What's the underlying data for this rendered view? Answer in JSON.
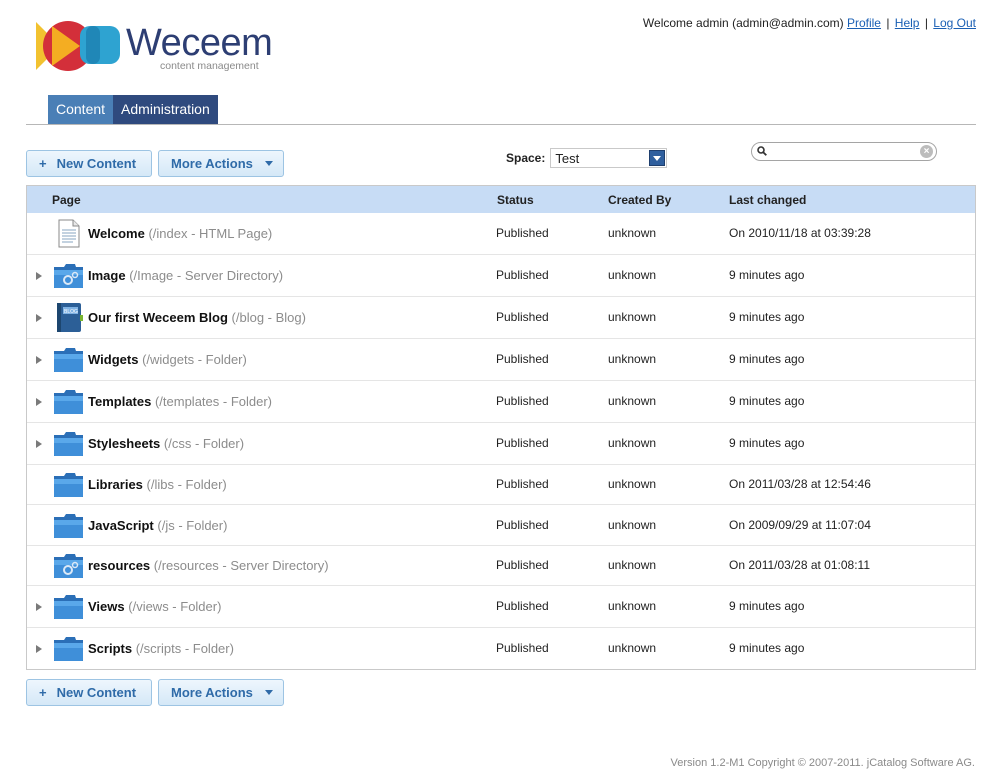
{
  "logo": {
    "word": "Weceem",
    "sub": "content management"
  },
  "user": {
    "welcome": "Welcome admin (admin@admin.com)",
    "profile": "Profile",
    "help": "Help",
    "logout": "Log Out",
    "sep": "|"
  },
  "tabs": [
    {
      "label": "Content",
      "active": true
    },
    {
      "label": "Administration",
      "active": false
    }
  ],
  "toolbar": {
    "new_content": "New Content",
    "new_content_icon": "+",
    "more_actions": "More Actions"
  },
  "space": {
    "label": "Space:",
    "value": "Test"
  },
  "search": {
    "placeholder": "",
    "value": ""
  },
  "table": {
    "headers": {
      "page": "Page",
      "status": "Status",
      "created_by": "Created By",
      "last_changed": "Last changed"
    },
    "rows": [
      {
        "name": "Welcome",
        "detail": "(/index - HTML Page)",
        "icon": "document-icon",
        "expandable": false,
        "status": "Published",
        "created_by": "unknown",
        "last_changed": "On 2010/11/18 at 03:39:28"
      },
      {
        "name": "Image",
        "detail": "(/Image - Server Directory)",
        "icon": "server-directory-icon",
        "expandable": true,
        "status": "Published",
        "created_by": "unknown",
        "last_changed": "9 minutes ago"
      },
      {
        "name": "Our first Weceem Blog",
        "detail": "(/blog - Blog)",
        "icon": "blog-icon",
        "expandable": true,
        "status": "Published",
        "created_by": "unknown",
        "last_changed": "9 minutes ago"
      },
      {
        "name": "Widgets",
        "detail": "(/widgets - Folder)",
        "icon": "folder-icon",
        "expandable": true,
        "status": "Published",
        "created_by": "unknown",
        "last_changed": "9 minutes ago"
      },
      {
        "name": "Templates",
        "detail": "(/templates - Folder)",
        "icon": "folder-icon",
        "expandable": true,
        "status": "Published",
        "created_by": "unknown",
        "last_changed": "9 minutes ago"
      },
      {
        "name": "Stylesheets",
        "detail": "(/css - Folder)",
        "icon": "folder-icon",
        "expandable": true,
        "status": "Published",
        "created_by": "unknown",
        "last_changed": "9 minutes ago"
      },
      {
        "name": "Libraries",
        "detail": "(/libs - Folder)",
        "icon": "folder-icon",
        "expandable": false,
        "status": "Published",
        "created_by": "unknown",
        "last_changed": "On 2011/03/28 at 12:54:46"
      },
      {
        "name": "JavaScript",
        "detail": "(/js - Folder)",
        "icon": "folder-icon",
        "expandable": false,
        "status": "Published",
        "created_by": "unknown",
        "last_changed": "On 2009/09/29 at 11:07:04"
      },
      {
        "name": "resources",
        "detail": "(/resources - Server Directory)",
        "icon": "server-directory-icon",
        "expandable": false,
        "status": "Published",
        "created_by": "unknown",
        "last_changed": "On 2011/03/28 at 01:08:11"
      },
      {
        "name": "Views",
        "detail": "(/views - Folder)",
        "icon": "folder-icon",
        "expandable": true,
        "status": "Published",
        "created_by": "unknown",
        "last_changed": "9 minutes ago"
      },
      {
        "name": "Scripts",
        "detail": "(/scripts - Folder)",
        "icon": "folder-icon",
        "expandable": true,
        "status": "Published",
        "created_by": "unknown",
        "last_changed": "9 minutes ago"
      }
    ]
  },
  "footer": {
    "text": "Version 1.2-M1 Copyright © 2007-2011. jCatalog Software AG."
  },
  "colors": {
    "tab_active": "#4a7fb6",
    "tab_inactive": "#2f4a7e",
    "header_bg": "#c7dcf5",
    "link": "#1a5fb4",
    "brand": "#2d3e73"
  }
}
